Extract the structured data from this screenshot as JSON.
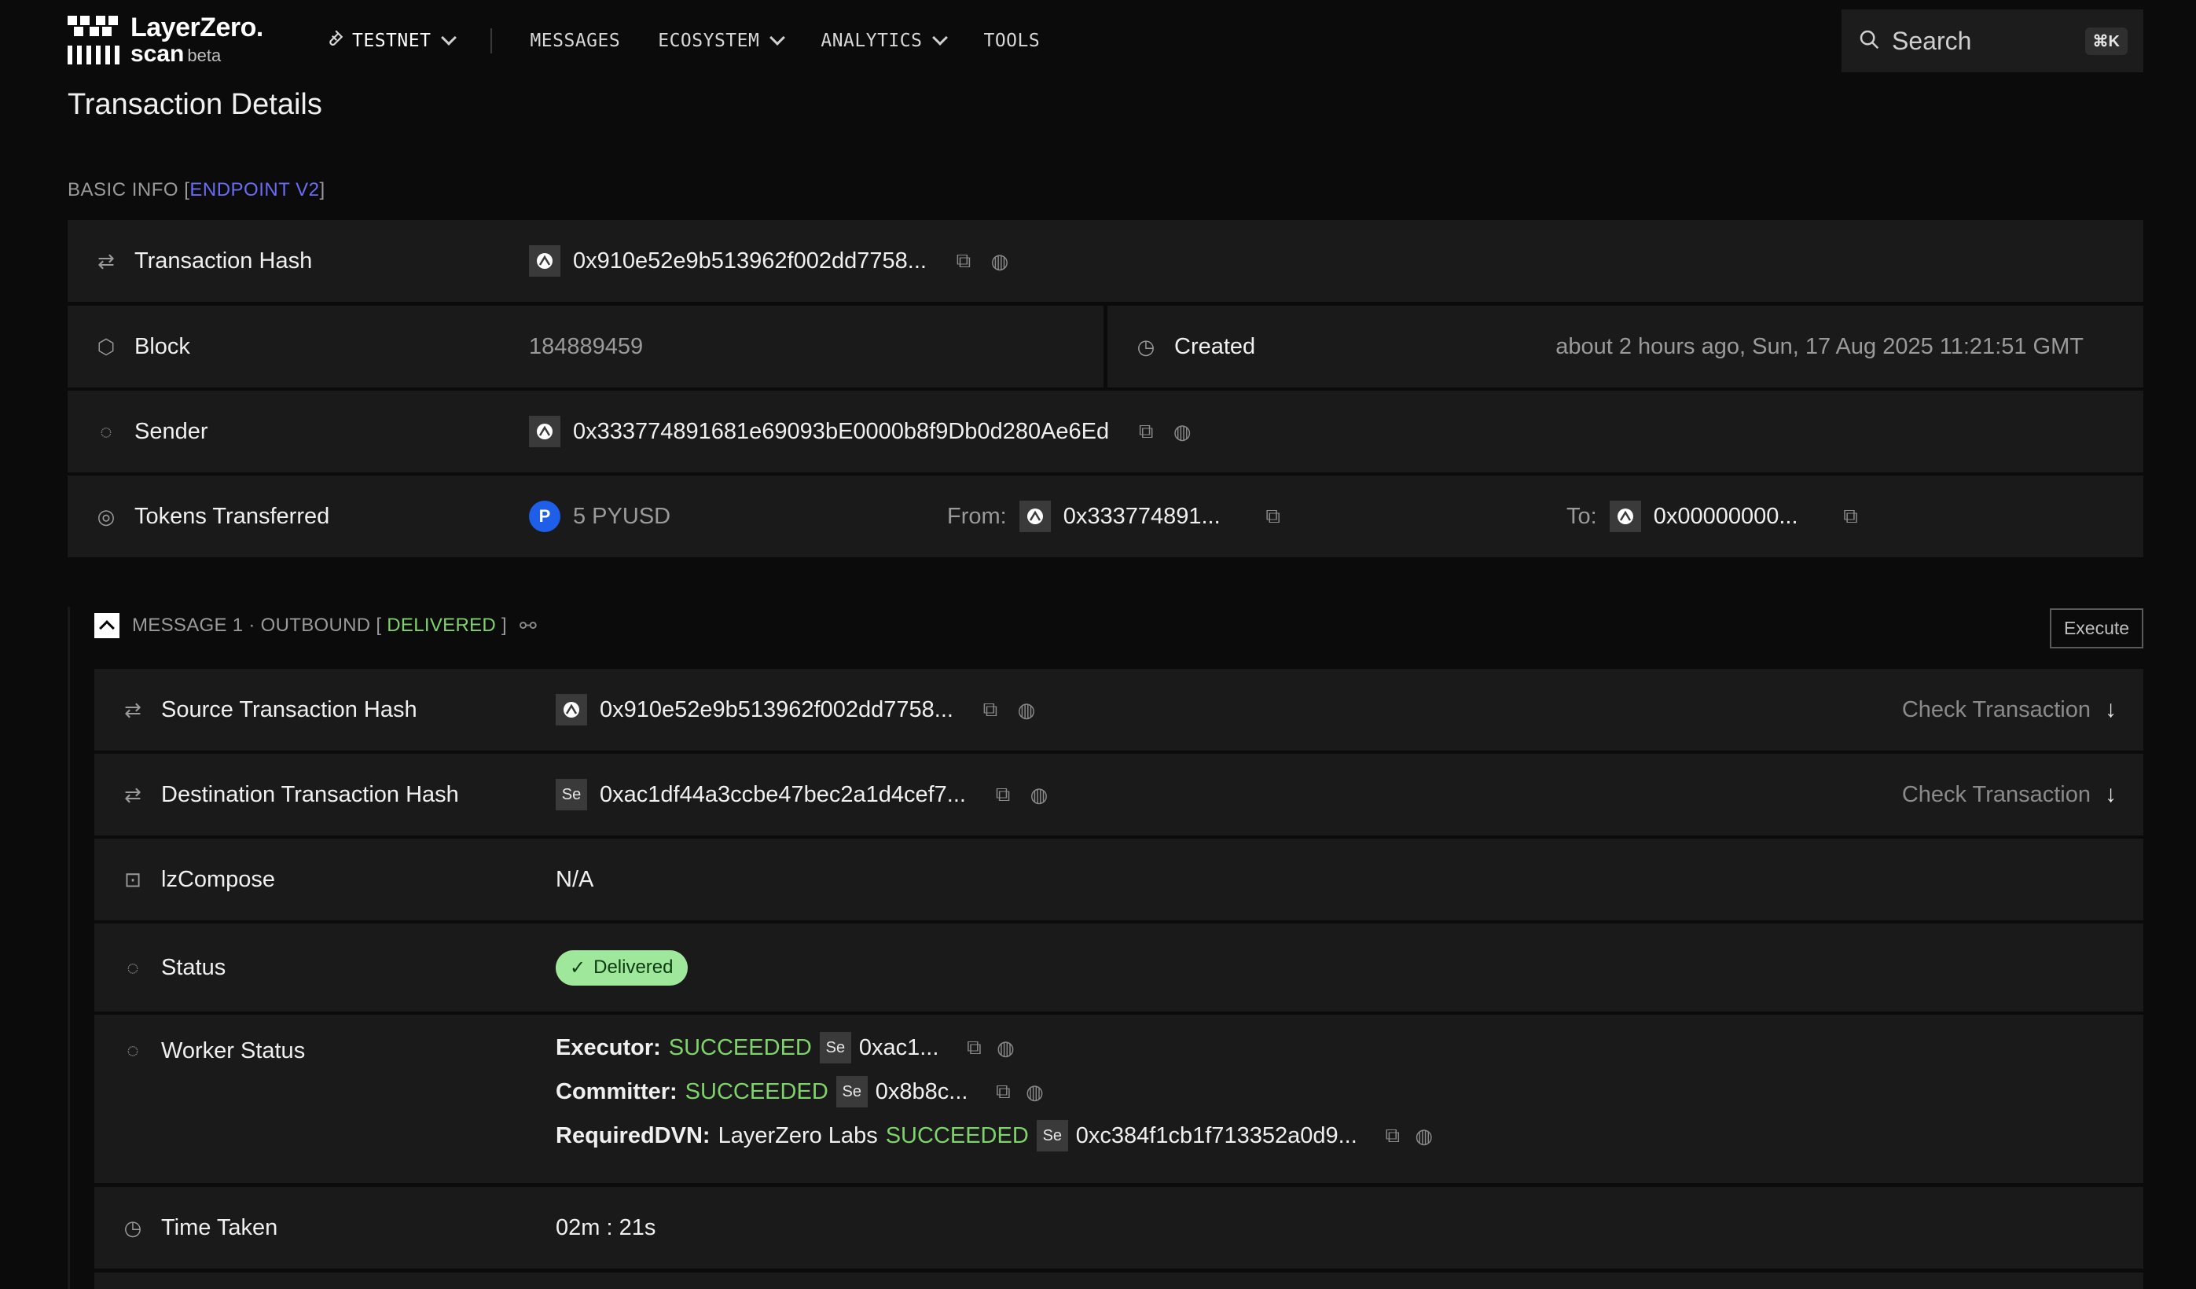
{
  "nav": {
    "logo_line1": "LayerZero.",
    "logo_line2": "scan",
    "logo_beta": "beta",
    "network": "TESTNET",
    "links": [
      "MESSAGES",
      "ECOSYSTEM",
      "ANALYTICS",
      "TOOLS"
    ],
    "search_label": "Search",
    "search_kbd": "⌘K"
  },
  "page": {
    "title": "Transaction Details",
    "section_prefix": "BASIC INFO [",
    "section_endpoint": "ENDPOINT V2",
    "section_suffix": "]"
  },
  "basic": {
    "tx_hash_label": "Transaction Hash",
    "tx_hash": "0x910e52e9b513962f002dd7758...",
    "block_label": "Block",
    "block": "184889459",
    "created_label": "Created",
    "created": "about 2 hours ago, Sun, 17 Aug 2025 11:21:51 GMT",
    "sender_label": "Sender",
    "sender": "0x333774891681e69093bE0000b8f9Db0d280Ae6Ed",
    "tokens_label": "Tokens Transferred",
    "tokens": "5 PYUSD",
    "from_label": "From:",
    "from": "0x333774891...",
    "to_label": "To:",
    "to": "0x00000000..."
  },
  "message": {
    "head_prefix": "MESSAGE 1 · OUTBOUND [",
    "head_status": "DELIVERED",
    "head_suffix": "]",
    "execute": "Execute",
    "src_label": "Source Transaction Hash",
    "src_hash": "0x910e52e9b513962f002dd7758...",
    "dst_label": "Destination Transaction Hash",
    "dst_hash": "0xac1df44a3ccbe47bec2a1d4cef7...",
    "check_tx": "Check Transaction",
    "chain_se": "Se",
    "lzcompose_label": "lzCompose",
    "lzcompose": "N/A",
    "status_label": "Status",
    "status": "Delivered",
    "worker_label": "Worker Status",
    "executor_label": "Executor:",
    "executor_status": "SUCCEEDED",
    "executor_addr": "0xac1...",
    "committer_label": "Committer:",
    "committer_status": "SUCCEEDED",
    "committer_addr": "0x8b8c...",
    "dvn_label": "RequiredDVN:",
    "dvn_name": "LayerZero Labs",
    "dvn_status": "SUCCEEDED",
    "dvn_addr": "0xc384f1cb1f713352a0d9...",
    "time_label": "Time Taken",
    "time": "02m : 21s"
  },
  "colors": {
    "accent": "#6b6cf6",
    "success": "#7ed36a",
    "badge_bg": "#9fe79b",
    "row_bg": "#1a1a1a"
  }
}
